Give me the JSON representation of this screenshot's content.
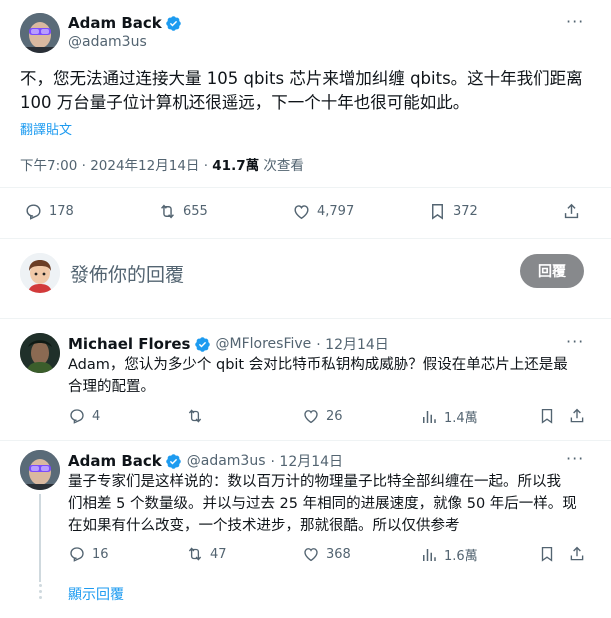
{
  "main_tweet": {
    "author_name": "Adam Back",
    "author_handle": "@adam3us",
    "text_line1": "不，您无法通过连接大量 105 qbits 芯片来增加纠缠 qbits。这十年我们距离",
    "text_line2": "100 万台量子位计算机还很遥远，下一个十年也很可能如此。",
    "translate_label": "翻譯貼文",
    "meta_time": "下午7:00 · 2024年12月14日 · ",
    "meta_views_count": "41.7萬",
    "meta_views_label": " 次查看",
    "replies": "178",
    "retweets": "655",
    "likes": "4,797",
    "bookmarks": "372",
    "more_label": "···"
  },
  "composer": {
    "placeholder": "發佈你的回覆",
    "reply_button": "回覆"
  },
  "replies": [
    {
      "author_name": "Michael Flores",
      "author_handle": "@MFloresFive",
      "date": "· 12月14日",
      "text_line1": "Adam，您认为多少个 qbit 会对比特币私钥构成威胁？假设在单芯片上还是最",
      "text_line2": "合理的配置。",
      "replies": "4",
      "retweets": "",
      "likes": "26",
      "views": "1.4萬",
      "more_label": "···"
    },
    {
      "author_name": "Adam Back",
      "author_handle": "@adam3us",
      "date": "· 12月14日",
      "text_line1": "量子专家们是这样说的：数以百万计的物理量子比特全部纠缠在一起。所以我",
      "text_line2": "们相差 5 个数量级。并以与过去 25 年相同的进展速度，就像 50 年后一样。现",
      "text_line3": "在如果有什么改变，一个技术进步，那就很酷。所以仅供参考",
      "replies": "16",
      "retweets": "47",
      "likes": "368",
      "views": "1.6萬",
      "more_label": "···"
    }
  ],
  "show_replies_label": "顯示回覆",
  "colors": {
    "accent": "#1d9bf0",
    "text": "#0f1419",
    "muted": "#536471",
    "button_bg": "#87898c"
  }
}
